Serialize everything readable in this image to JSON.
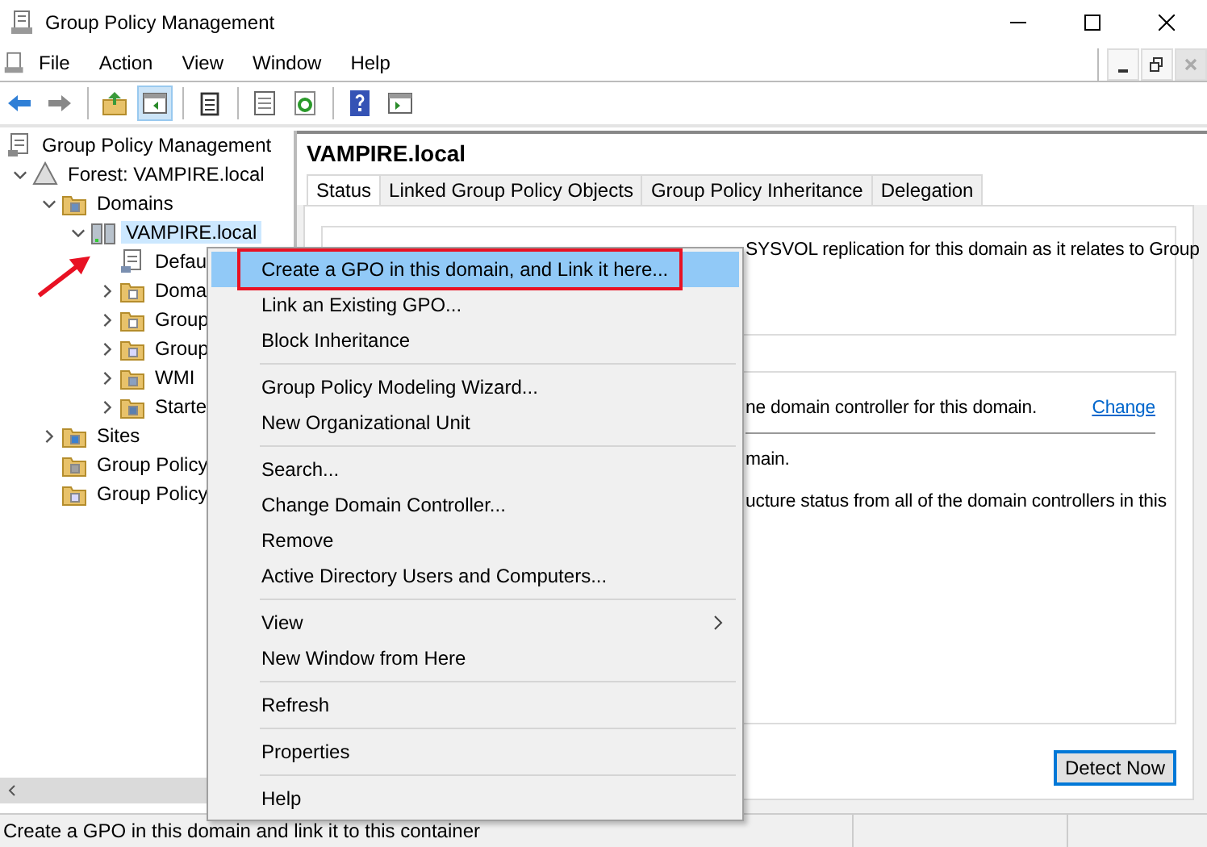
{
  "window": {
    "title": "Group Policy Management"
  },
  "menu_bar": [
    "File",
    "Action",
    "View",
    "Window",
    "Help"
  ],
  "mdi_controls": [
    {
      "kind": "minimize",
      "disabled": false
    },
    {
      "kind": "restore",
      "disabled": false
    },
    {
      "kind": "close",
      "disabled": true
    }
  ],
  "toolbar": [
    {
      "kind": "back",
      "pressed": false
    },
    {
      "kind": "forward",
      "pressed": false
    },
    {
      "kind": "sep"
    },
    {
      "kind": "up",
      "pressed": false
    },
    {
      "kind": "tree",
      "pressed": true
    },
    {
      "kind": "sep"
    },
    {
      "kind": "clipboard",
      "pressed": false
    },
    {
      "kind": "sep"
    },
    {
      "kind": "properties",
      "pressed": false
    },
    {
      "kind": "refresh",
      "pressed": false
    },
    {
      "kind": "sep"
    },
    {
      "kind": "help",
      "pressed": false
    },
    {
      "kind": "pane",
      "pressed": false
    }
  ],
  "tree": [
    {
      "label": "Group Policy Management",
      "kind": "console",
      "selected": false,
      "children": [
        {
          "label": "Forest: VAMPIRE.local",
          "kind": "forest",
          "expanded": true,
          "selected": false,
          "children": [
            {
              "label": "Domains",
              "kind": "domains",
              "expanded": true,
              "selected": false,
              "children": [
                {
                  "label": "VAMPIRE.local",
                  "kind": "domain",
                  "expanded": true,
                  "selected": true,
                  "children": [
                    {
                      "label": "Defau",
                      "kind": "gpo",
                      "selected": false
                    },
                    {
                      "label": "Doma",
                      "kind": "ou",
                      "expanded": false,
                      "selected": false
                    },
                    {
                      "label": "Group",
                      "kind": "ou",
                      "expanded": false,
                      "selected": false
                    },
                    {
                      "label": "Group",
                      "kind": "doc",
                      "expanded": false,
                      "selected": false
                    },
                    {
                      "label": "WMI",
                      "kind": "wmi",
                      "expanded": false,
                      "selected": false
                    },
                    {
                      "label": "Starte",
                      "kind": "starter",
                      "expanded": false,
                      "selected": false
                    }
                  ]
                }
              ]
            },
            {
              "label": "Sites",
              "kind": "sites",
              "expanded": false,
              "selected": false
            },
            {
              "label": "Group Policy",
              "kind": "modeling",
              "selected": false
            },
            {
              "label": "Group Policy",
              "kind": "doc",
              "selected": false
            }
          ]
        }
      ]
    }
  ],
  "details": {
    "heading": "VAMPIRE.local",
    "tabs": [
      {
        "label": "Status",
        "selected": true
      },
      {
        "label": "Linked Group Policy Objects",
        "selected": false
      },
      {
        "label": "Group Policy Inheritance",
        "selected": false
      },
      {
        "label": "Delegation",
        "selected": false
      }
    ],
    "intro_rest": "SYSVOL replication for this domain as it relates to Group",
    "controller_text": "ne domain controller for this domain.",
    "change_link": "Change",
    "line_2": "main.",
    "line_3": "ucture status from all of the domain controllers in this",
    "detect_button": "Detect Now"
  },
  "context_menu": [
    {
      "label": "Create a GPO in this domain, and Link it here...",
      "kind": "item",
      "selected": true,
      "highlighted": true
    },
    {
      "label": "Link an Existing GPO...",
      "kind": "item",
      "selected": false,
      "highlighted": false
    },
    {
      "label": "Block Inheritance",
      "kind": "item",
      "selected": false,
      "highlighted": false
    },
    {
      "kind": "separator"
    },
    {
      "label": "Group Policy Modeling Wizard...",
      "kind": "item",
      "selected": false,
      "highlighted": false
    },
    {
      "label": "New Organizational Unit",
      "kind": "item",
      "selected": false,
      "highlighted": false
    },
    {
      "kind": "separator"
    },
    {
      "label": "Search...",
      "kind": "item",
      "selected": false,
      "highlighted": false
    },
    {
      "label": "Change Domain Controller...",
      "kind": "item",
      "selected": false,
      "highlighted": false
    },
    {
      "label": "Remove",
      "kind": "item",
      "selected": false,
      "highlighted": false
    },
    {
      "label": "Active Directory Users and Computers...",
      "kind": "item",
      "selected": false,
      "highlighted": false
    },
    {
      "kind": "separator"
    },
    {
      "label": "View",
      "kind": "submenu",
      "selected": false,
      "highlighted": false
    },
    {
      "label": "New Window from Here",
      "kind": "item",
      "selected": false,
      "highlighted": false
    },
    {
      "kind": "separator"
    },
    {
      "label": "Refresh",
      "kind": "item",
      "selected": false,
      "highlighted": false
    },
    {
      "kind": "separator"
    },
    {
      "label": "Properties",
      "kind": "item",
      "selected": false,
      "highlighted": false
    },
    {
      "kind": "separator"
    },
    {
      "label": "Help",
      "kind": "item",
      "selected": false,
      "highlighted": false
    }
  ],
  "status_bar": "Create a GPO in this domain and link it to this container"
}
